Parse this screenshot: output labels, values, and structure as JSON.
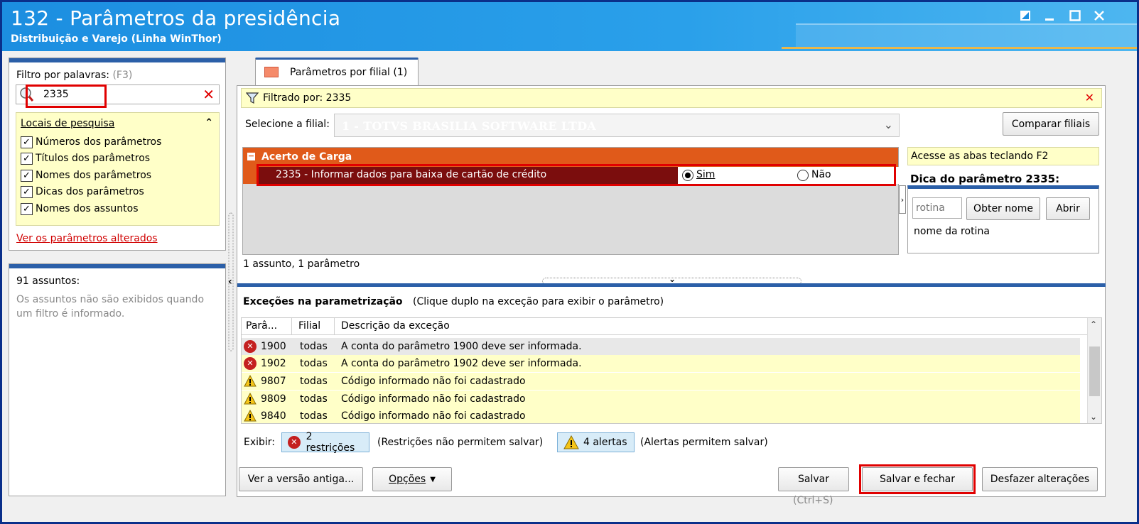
{
  "window": {
    "title": "132 - Parâmetros da presidência",
    "subtitle": "Distribuição e Varejo (Linha WinThor)"
  },
  "filter": {
    "label": "Filtro por palavras:",
    "shortcut": "(F3)",
    "value": "2335",
    "search_places_title": "Locais de pesquisa",
    "options": [
      {
        "label": "Números dos parâmetros",
        "checked": true
      },
      {
        "label": "Títulos dos parâmetros",
        "checked": true
      },
      {
        "label": "Nomes dos parâmetros",
        "checked": true
      },
      {
        "label": "Dicas dos parâmetros",
        "checked": true
      },
      {
        "label": "Nomes dos assuntos",
        "checked": true
      }
    ],
    "changed_link": "Ver os parâmetros alterados"
  },
  "subjects": {
    "count_label": "91 assuntos:",
    "message": "Os assuntos não são exibidos quando um filtro é informado."
  },
  "tab": {
    "label": "Parâmetros por filial",
    "count": "(1)"
  },
  "filtered_bar": {
    "text": "Filtrado por: 2335"
  },
  "branch": {
    "label": "Selecione a filial:",
    "value": "1 - TOTVS BRASILIA SOFTWARE LTDA",
    "compare_button": "Comparar filiais"
  },
  "group": {
    "title": "Acerto de Carga",
    "param_text": "2335 - Informar dados para baixa de cartão de crédito",
    "option_yes": "Sim",
    "option_no": "Não",
    "selected": "Sim"
  },
  "summary": "1 assunto, 1 parâmetro",
  "side": {
    "hint": "Acesse as abas teclando F2",
    "tip_title": "Dica do parâmetro 2335:",
    "rotina_placeholder": "rotina",
    "get_name_button": "Obter nome",
    "open_button": "Abrir",
    "rotina_name": "nome da rotina"
  },
  "exceptions": {
    "title": "Exceções na parametrização",
    "subtitle": "(Clique duplo na exceção para exibir o parâmetro)",
    "columns": [
      "Parâ...",
      "Filial",
      "Descrição da exceção"
    ],
    "rows": [
      {
        "type": "error",
        "param": "1900",
        "filial": "todas",
        "desc": "A conta do parâmetro 1900 deve ser informada."
      },
      {
        "type": "error",
        "param": "1902",
        "filial": "todas",
        "desc": "A conta do parâmetro 1902 deve ser informada."
      },
      {
        "type": "warning",
        "param": "9807",
        "filial": "todas",
        "desc": "Código informado não foi cadastrado"
      },
      {
        "type": "warning",
        "param": "9809",
        "filial": "todas",
        "desc": "Código informado não foi cadastrado"
      },
      {
        "type": "warning",
        "param": "9840",
        "filial": "todas",
        "desc": "Código informado não foi cadastrado"
      }
    ],
    "show_label": "Exibir:",
    "restrictions_chip": "2 restrições",
    "restrictions_note": "(Restrições não permitem salvar)",
    "alerts_chip": "4 alertas",
    "alerts_note": "(Alertas permitem salvar)"
  },
  "footer": {
    "old_version": "Ver a versão antiga...",
    "options": "Opções",
    "save": "Salvar",
    "save_shortcut": "(Ctrl+S)",
    "save_close": "Salvar e fechar",
    "undo": "Desfazer alterações"
  },
  "colors": {
    "group_header": "#e05a1a",
    "param_row": "#7b0d0d",
    "highlight_box": "#e00000",
    "hint_bg": "#ffffc8",
    "title_bar": "#2aa0ea"
  }
}
